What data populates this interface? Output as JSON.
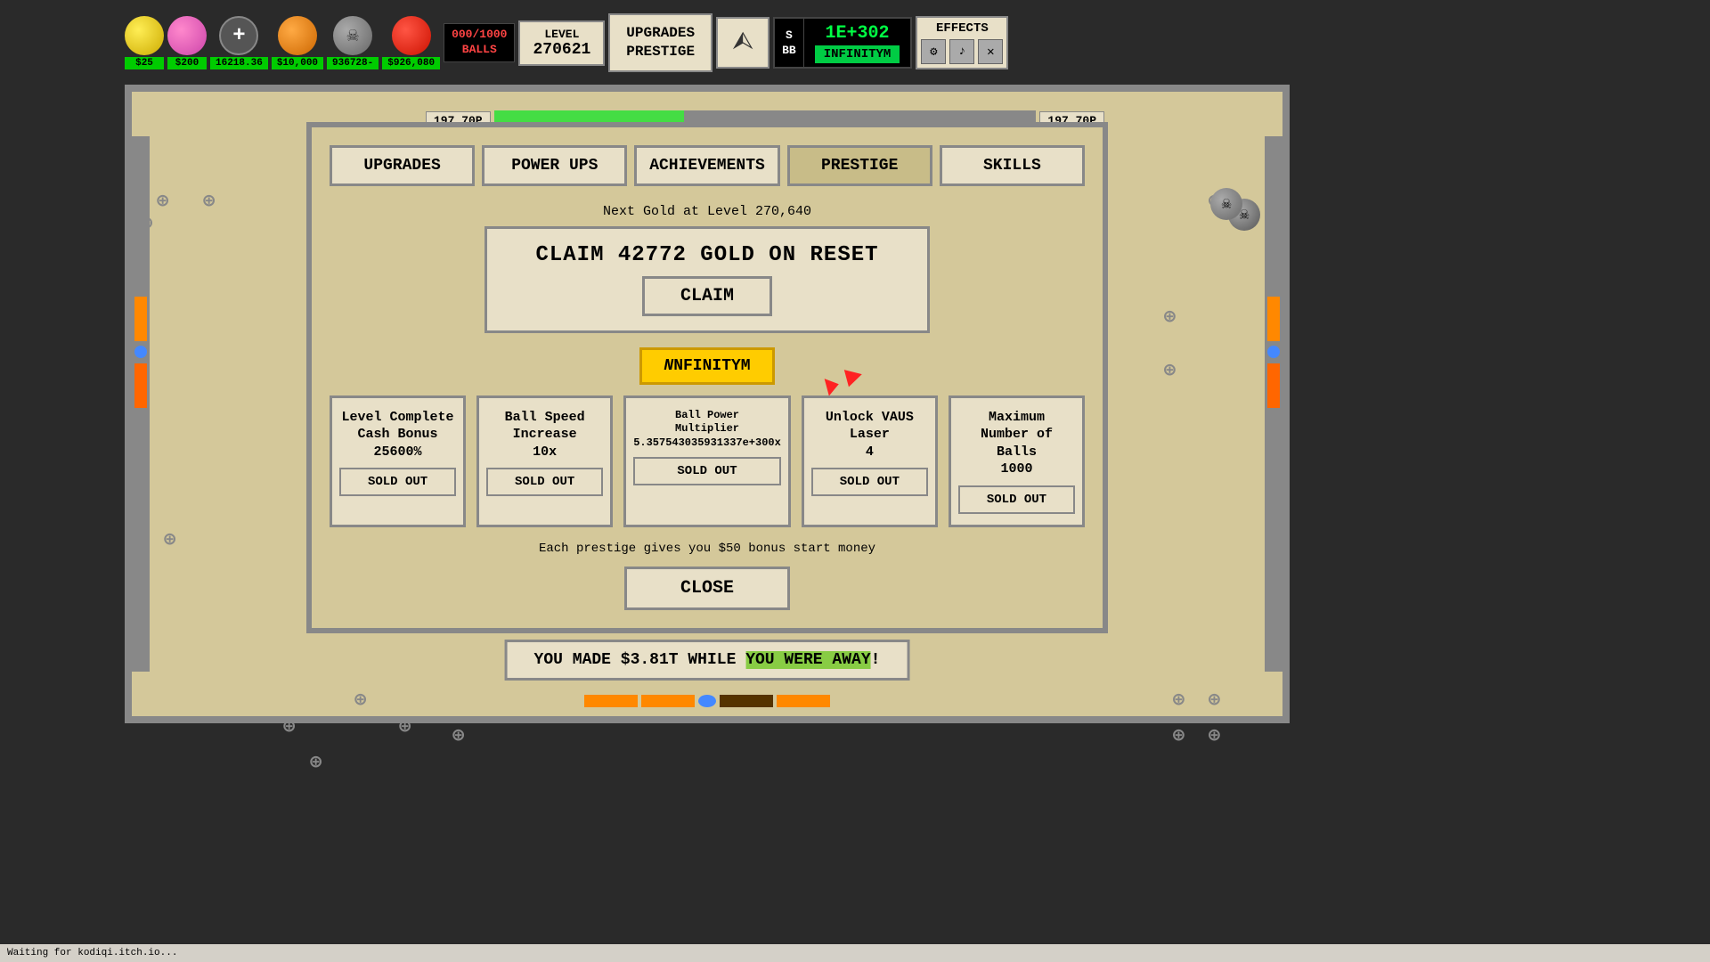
{
  "topbar": {
    "balls_counter": "000/1000\nBALLS",
    "level_label": "LEVEL",
    "level_value": "270621",
    "upgrades_prestige": "UPGRADES\nPRESTIGE",
    "ball_prices": [
      "$25",
      "$200",
      "16218.36",
      "$10,000",
      "936728-",
      "$926,080"
    ],
    "currency": {
      "s_label": "S",
      "bb_label": "BB",
      "value": "1E+302",
      "infinity": "INFINITYM"
    },
    "effects_label": "EFFECTS"
  },
  "board": {
    "progress_tooltip1": "197.70P",
    "progress_tooltip2": "197.70P",
    "progress_fill_pct": 35
  },
  "modal": {
    "tabs": [
      "UPGRADES",
      "POWER UPS",
      "ACHIEVEMENTS",
      "PRESTIGE",
      "SKILLS"
    ],
    "active_tab": "PRESTIGE",
    "next_gold_text": "Next Gold at Level 270,640",
    "claim_amount": "CLAIM 42772 GOLD ON RESET",
    "claim_btn": "CLAIM",
    "infinity_badge": "NFINITYM",
    "prestige_items": [
      {
        "name": "Level Complete\nCash Bonus\n25600%",
        "sold_out": "SOLD OUT"
      },
      {
        "name": "Ball Speed\nIncrease\n10x",
        "sold_out": "SOLD OUT"
      },
      {
        "name": "Ball Power\nMultiplier\n5.357543035931337e+300x",
        "sold_out": "SOLD OUT"
      },
      {
        "name": "Unlock VAUS\nLaser\n4",
        "sold_out": "SOLD OUT"
      },
      {
        "name": "Maximum\nNumber of\nBalls\n1000",
        "sold_out": "SOLD OUT"
      }
    ],
    "bonus_text": "Each prestige gives you $50 bonus start money",
    "close_btn": "CLOSE"
  },
  "notification": {
    "text_start": "YOU MADE $3.81T WHILE ",
    "text_highlight": "YOU WERE AWAY",
    "text_end": "!"
  },
  "status_bar": {
    "text": "Waiting for kodiqi.itch.io..."
  },
  "plus_signs": [
    "+",
    "+",
    "+",
    "+",
    "+",
    "+",
    "+",
    "+",
    "+",
    "+",
    "+",
    "+",
    "+",
    "+",
    "+"
  ]
}
